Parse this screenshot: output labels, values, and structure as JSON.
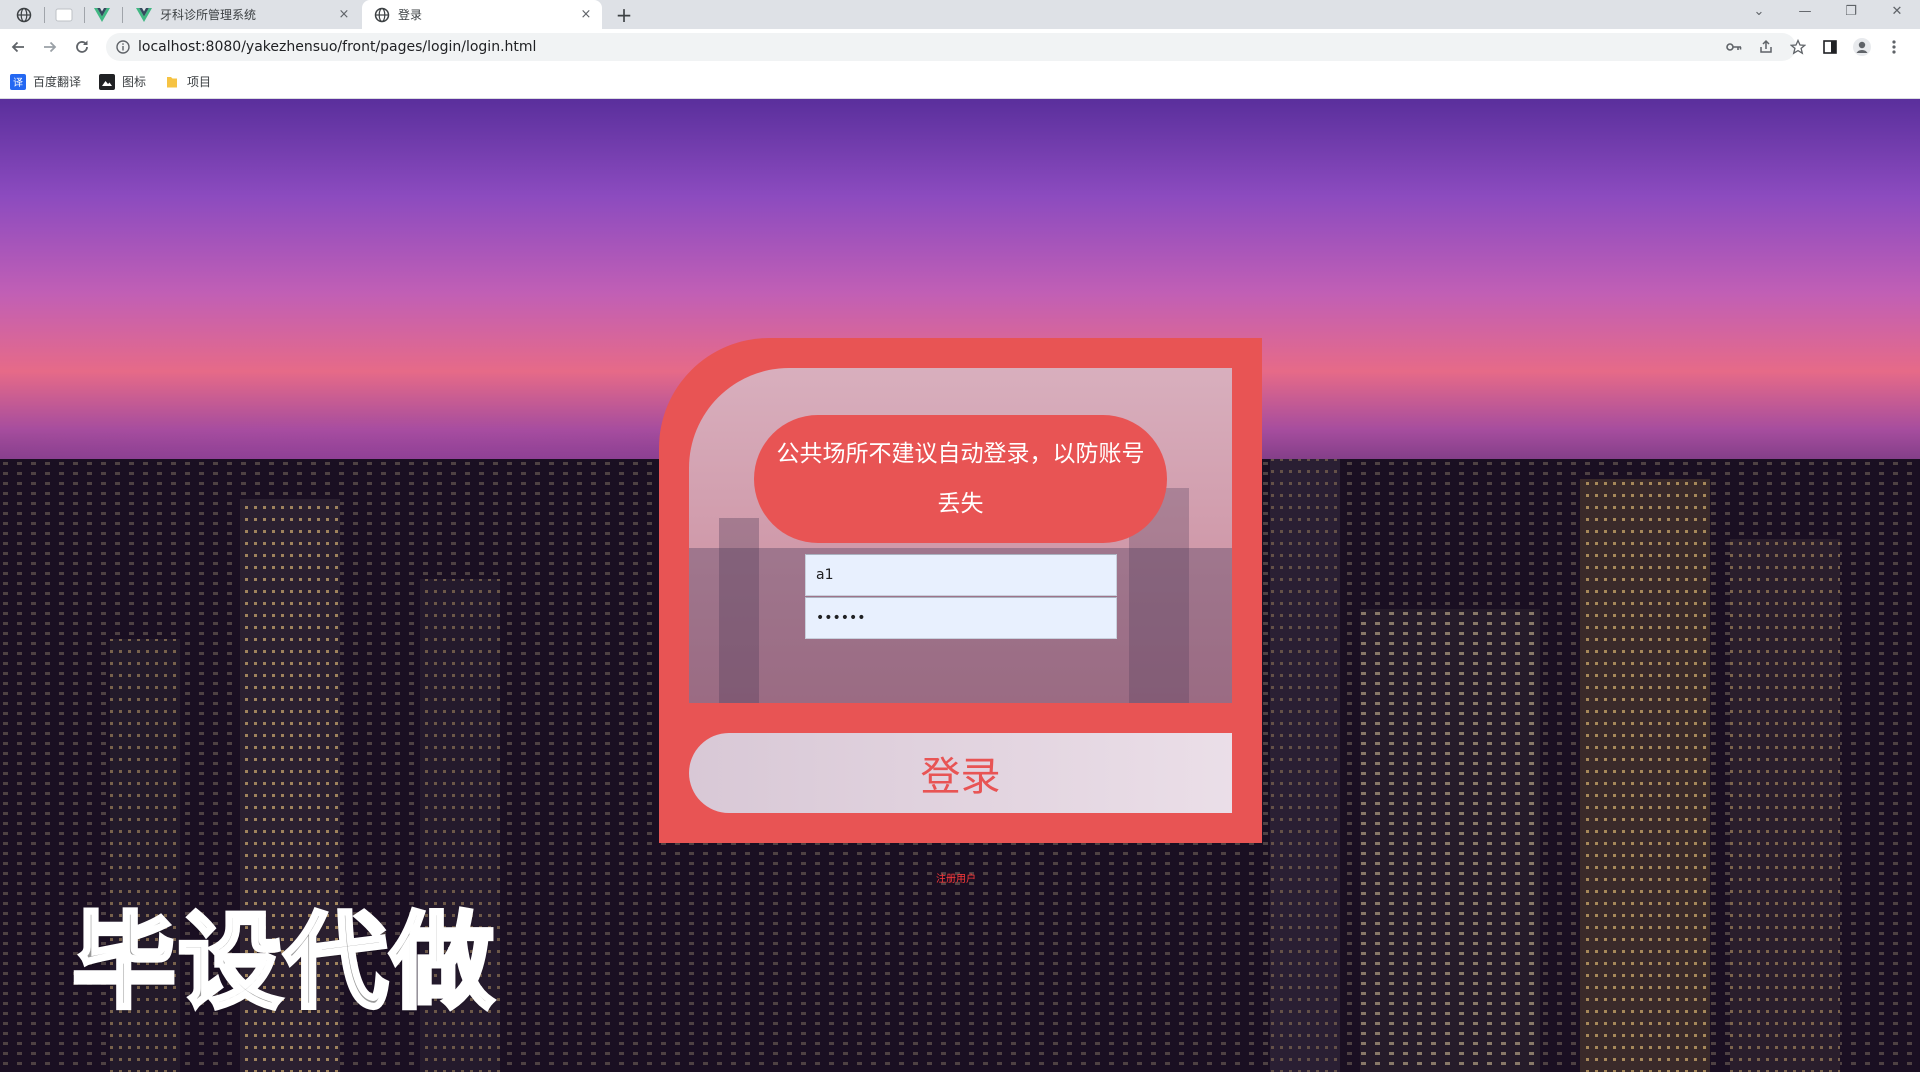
{
  "browser": {
    "tabs": [
      {
        "title": "牙科诊所管理系统",
        "active": false
      },
      {
        "title": "登录",
        "active": true
      }
    ],
    "tab_close_glyph": "×",
    "new_tab_glyph": "+",
    "window_controls": [
      "⌄",
      "—",
      "❐",
      "✕"
    ],
    "url": "localhost:8080/yakezhensuo/front/pages/login/login.html",
    "bookmarks": [
      {
        "label": "百度翻译",
        "icon": "translate-icon",
        "color": "#2468f2"
      },
      {
        "label": "图标",
        "icon": "image-icon",
        "color": "#202124"
      },
      {
        "label": "项目",
        "icon": "folder-icon",
        "color": "#f6c343"
      }
    ]
  },
  "login": {
    "notice": "公共场所不建议自动登录，以防账号丢失",
    "username_value": "a1",
    "password_value": "••••••",
    "login_label": "登录",
    "register_label": "注册用户"
  },
  "watermark": "毕设代做",
  "colors": {
    "accent": "#e85454",
    "field_bg": "#e8f0fe"
  }
}
